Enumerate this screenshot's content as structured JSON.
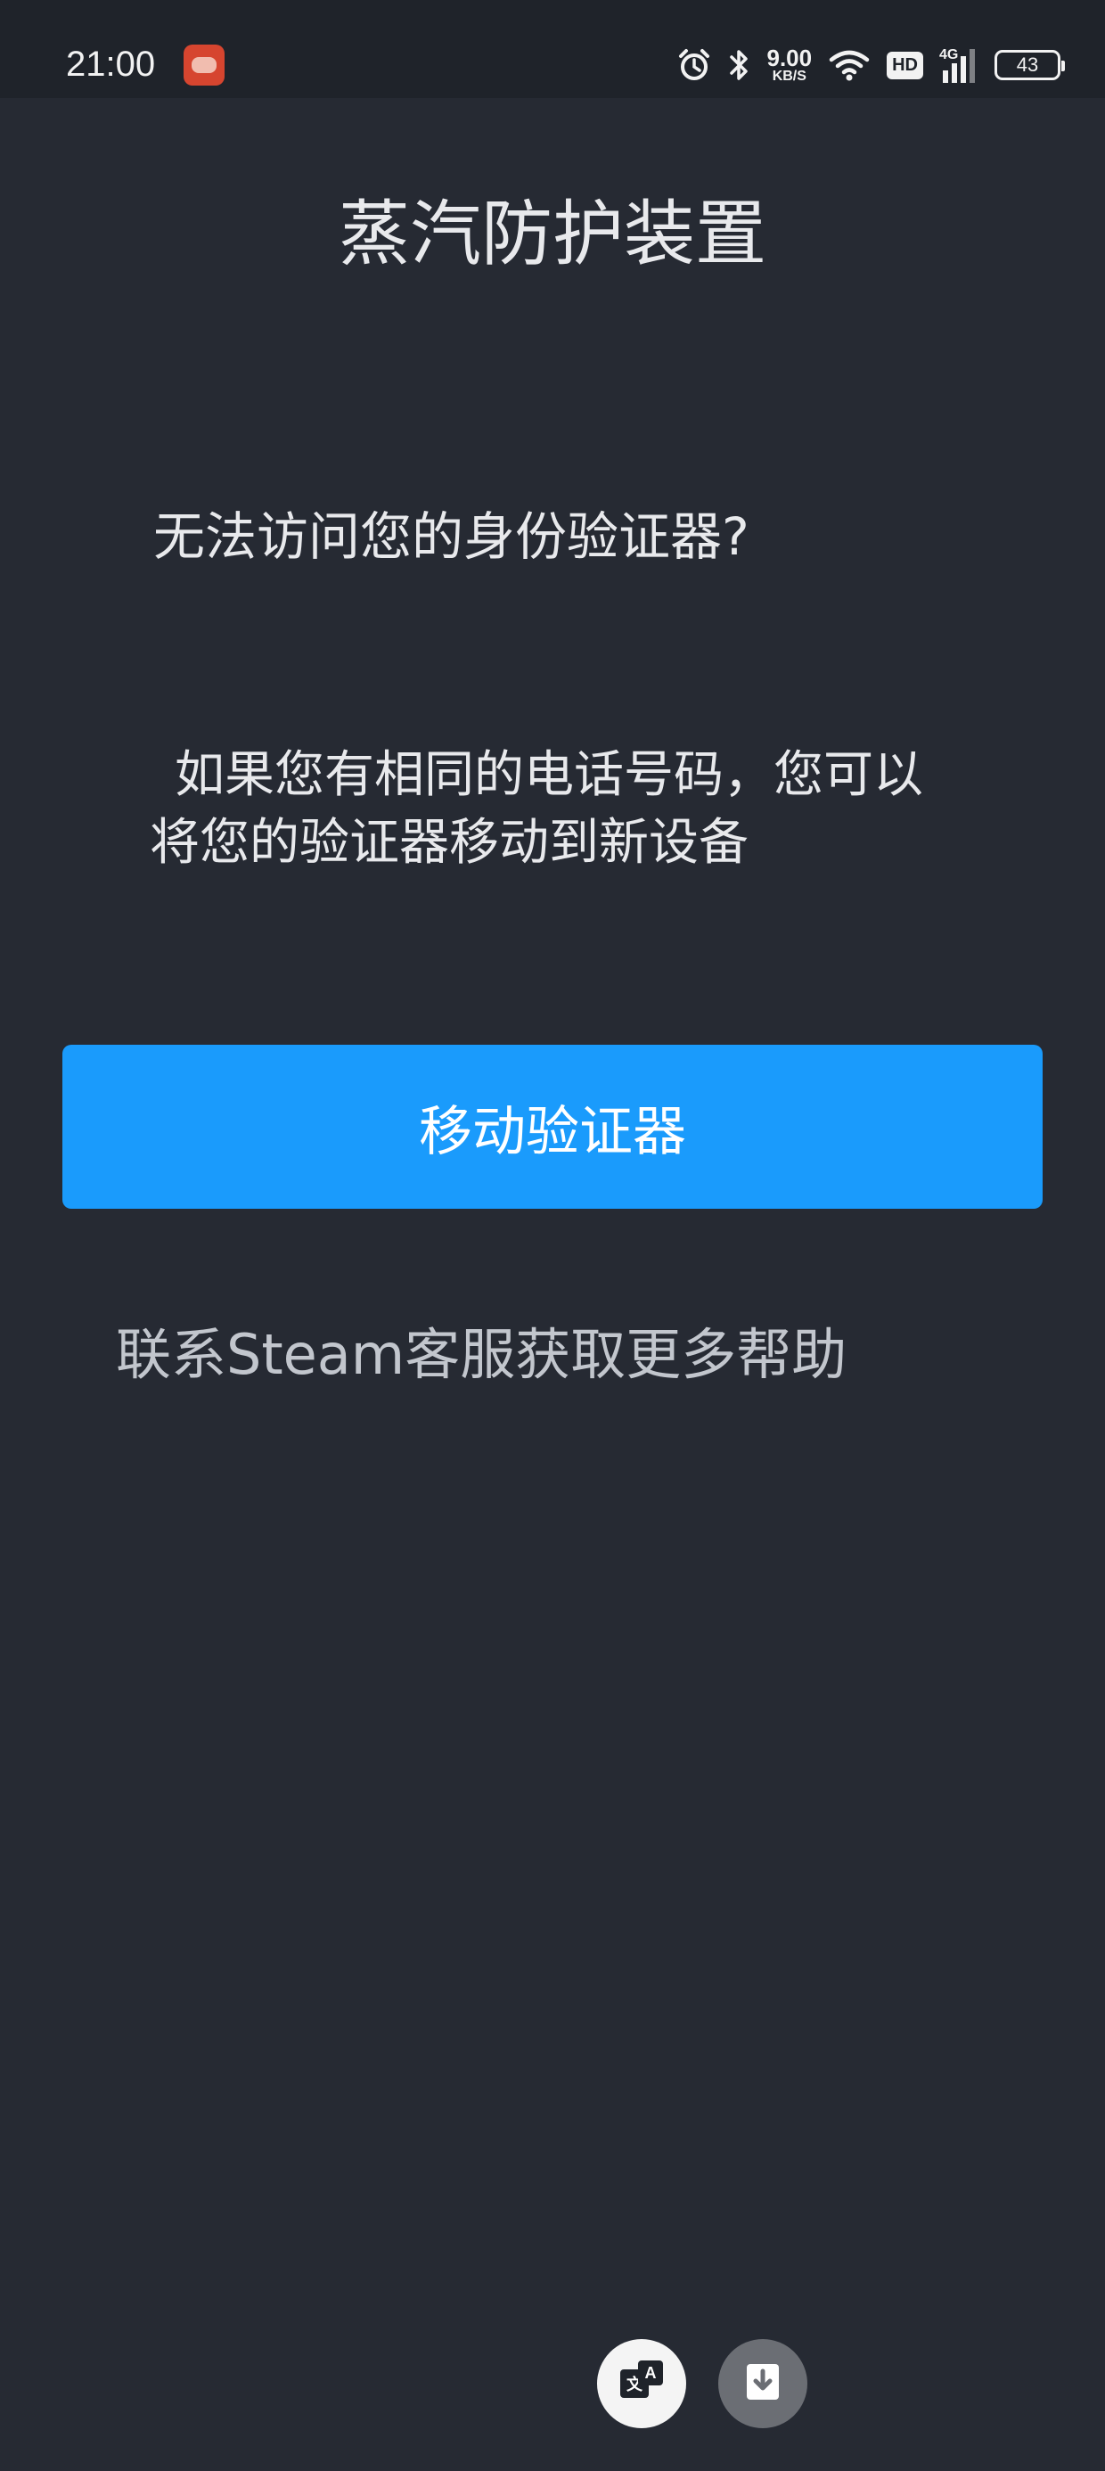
{
  "status_bar": {
    "time": "21:00",
    "net_speed_value": "9.00",
    "net_speed_unit": "KB/S",
    "hd_label": "HD",
    "signal_label": "4G",
    "battery_level": "43",
    "icons": [
      "app-notification-icon",
      "alarm-icon",
      "bluetooth-icon",
      "wifi-icon",
      "signal-icon",
      "battery-icon"
    ]
  },
  "page": {
    "title": "蒸汽防护装置",
    "question": "无法访问您的身份验证器?",
    "description": "如果您有相同的电话号码，您可以将您的验证器移动到新设备",
    "move_button_label": "移动验证器",
    "support_link": "联系Steam客服获取更多帮助"
  },
  "floating_actions": {
    "icons": [
      "translate-icon",
      "download-icon"
    ]
  },
  "colors": {
    "background": "#262a33",
    "status_bar": "#1f232a",
    "primary_button": "#1a9bfc",
    "link_text": "#c2c6cd"
  }
}
